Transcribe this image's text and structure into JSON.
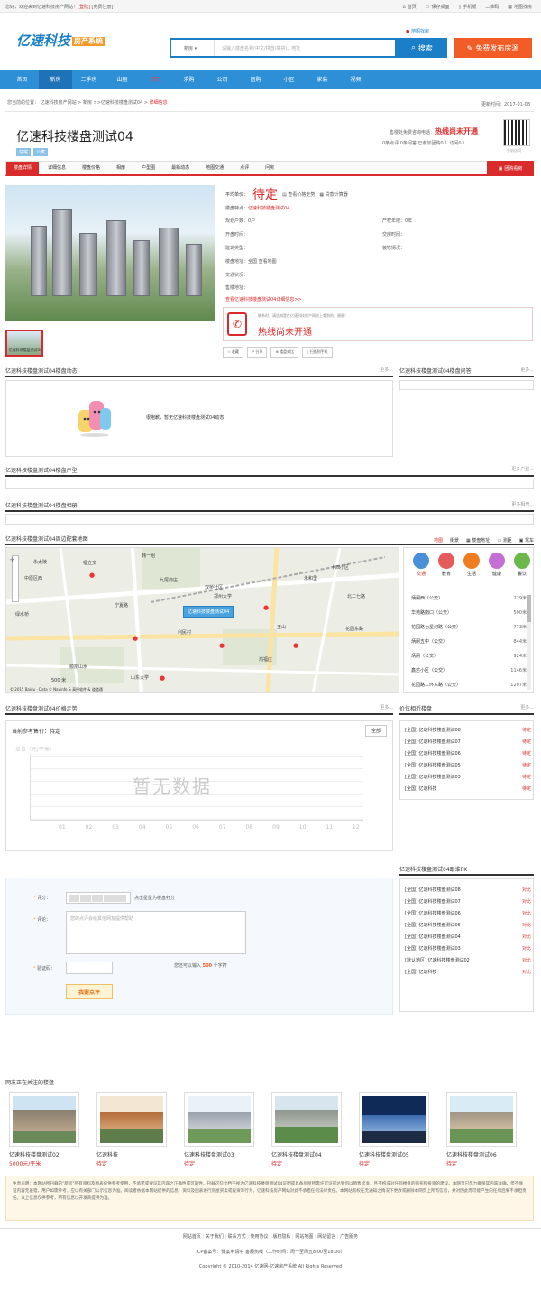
{
  "topbar": {
    "welcome": "您好，欢迎来到亿速科技房产网站！",
    "login": "[登陆]",
    "register": "[免费注册]",
    "links": [
      "首页",
      "保存桌面",
      "手机版",
      "二维码",
      "地图找房"
    ]
  },
  "header": {
    "logo": "亿速科技",
    "logo_tag": "房产系统",
    "map_find": "地图找房",
    "search_select": "新房",
    "search_placeholder": "请输入楼盘名称(中文/拼音/简拼)、地址",
    "search_button": "搜索",
    "publish_button": "免费发布房源"
  },
  "nav": [
    "首页",
    "新房",
    "二手房",
    "出租",
    "资讯",
    "求购",
    "公司",
    "团购",
    "小区",
    "家装",
    "视频"
  ],
  "crumb": {
    "text": "您当前的位置：  亿速科技房产网站  >  新房  >>亿速科技楼盘测试04  >",
    "current": "详细信息"
  },
  "update_time": "更新时间：2017-01-08",
  "property": {
    "title": "亿速科技楼盘测试04",
    "tags": [
      "住宅",
      "公寓"
    ],
    "hotline_label": "售楼处免费咨询电话：",
    "hotline": "热线尚未开通",
    "stats": "0条点评  0条问答  已参加团购0人  访问0人",
    "qr_label": "手机访问"
  },
  "tabs": [
    "楼盘详情",
    "详细信息",
    "楼盘价格",
    "相册",
    "户型图",
    "最新动态",
    "地图交通",
    "点评",
    "问房"
  ],
  "group_button": "团购看房",
  "thumb_label": "亿速科技楼盘测试04",
  "info": {
    "price_label": "平均单价：",
    "price": "待定",
    "price_trend": "查看价格走势",
    "loan_calc": "贷款计算器",
    "feature_label": "楼盘特点：",
    "feature": "亿速科技楼盘测试04",
    "rows": [
      [
        "规划户数：",
        "0户",
        "产权年限：",
        "0年"
      ],
      [
        "开盘时间：",
        "",
        "交房时间：",
        ""
      ],
      [
        "建筑类型：",
        "",
        "装修情况：",
        ""
      ],
      [
        "楼盘地址：",
        "全国   查看地图",
        "",
        ""
      ],
      [
        "交通状况：",
        "",
        "",
        ""
      ],
      [
        "售楼地址：",
        "",
        "",
        ""
      ]
    ],
    "more": "查看亿速科技楼盘测试04详细信息>>",
    "hot_note": "联系时，请告知是在亿速科技房产网站上看到的，谢谢！",
    "hot_big": "热线尚未开通",
    "tools": [
      "收藏",
      "分享",
      "楼盘对比",
      "扫描到手机"
    ]
  },
  "sections": {
    "dynamic": "亿速科技楼盘测试04楼盘动态",
    "qa": "亿速科技楼盘测试04楼盘问答",
    "more": "更多...",
    "nodata": "很抱歉，暂无亿速科技楼盘测试04动态",
    "layout": "亿速科技楼盘测试04楼盘户型",
    "layout_more": "更多户型...",
    "album": "亿速科技楼盘测试04楼盘相册",
    "album_more": "更多相册...",
    "map": "亿速科技楼盘测试04周边配套地图",
    "price": "亿速科技楼盘测试04价格走势",
    "similar": "价位相近楼盘",
    "pk": "亿速科技楼盘测试04跟谁PK",
    "watch": "网友正在关注的楼盘"
  },
  "map": {
    "tabs": [
      "地图",
      "街景",
      "楼盘地址",
      "测距",
      "驾车"
    ],
    "marker": "亿速科技楼盘测试04",
    "scale": "500 米",
    "copyright": "© 2015 Baidu - Data © Navinfo & 高德软件 & 道道通",
    "places": [
      "永太陵",
      "福立交",
      "韩一组",
      "中原区西",
      "双桥社区",
      "九尾商庄",
      "绿水桥",
      "永和里",
      "北二七路",
      "郑州大学",
      "十四小区",
      "王山",
      "花园东路",
      "山东大学",
      "利民村",
      "宁夏路",
      "鸿福庄",
      "顺凯山水"
    ],
    "cats": [
      "交通",
      "教育",
      "生活",
      "健康",
      "餐饮"
    ],
    "bus": [
      [
        "炳闸西（公交）",
        "229米"
      ],
      [
        "华苑路南口（公交）",
        "500米"
      ],
      [
        "花园路七星河路（公交）",
        "773米"
      ],
      [
        "炳闸五中（公交）",
        "844米"
      ],
      [
        "炳闸（公交）",
        "924米"
      ],
      [
        "鑫达小区（公交）",
        "1146米"
      ],
      [
        "花园路二环东路（公交）",
        "1207米"
      ]
    ]
  },
  "price_chart": {
    "ref_label": "当前参考售价：",
    "ref_value": "待定",
    "all_button": "全部",
    "unit": "单位（元/平米）",
    "nodata": "暂无数据",
    "months": [
      "01",
      "02",
      "03",
      "04",
      "05",
      "06",
      "07",
      "08",
      "09",
      "10",
      "11",
      "12"
    ]
  },
  "similar": [
    [
      "[全国] 亿速科技楼盘测试08",
      "待定"
    ],
    [
      "[全国] 亿速科技楼盘测试07",
      "待定"
    ],
    [
      "[全国] 亿速科技楼盘测试06",
      "待定"
    ],
    [
      "[全国] 亿速科技楼盘测试05",
      "待定"
    ],
    [
      "[全国] 亿速科技楼盘测试03",
      "待定"
    ],
    [
      "[全国] 亿速科技",
      "待定"
    ]
  ],
  "pk": [
    [
      "[全国] 亿速科技楼盘测试08",
      "对比"
    ],
    [
      "[全国] 亿速科技楼盘测试07",
      "对比"
    ],
    [
      "[全国] 亿速科技楼盘测试06",
      "对比"
    ],
    [
      "[全国] 亿速科技楼盘测试05",
      "对比"
    ],
    [
      "[全国] 亿速科技楼盘测试04",
      "对比"
    ],
    [
      "[全国] 亿速科技楼盘测试03",
      "对比"
    ],
    [
      "[默认地区] 亿速科技楼盘测试02",
      "对比"
    ],
    [
      "[全国] 亿速科技",
      "对比"
    ]
  ],
  "comment": {
    "score_label": "评分：",
    "score_hint": "点击星星为楼盘打分",
    "review_label": "评论：",
    "review_placeholder": "您的点评会给其他网友提供帮助",
    "code_label": "验证码：",
    "limit_prefix": "您还可以输入",
    "limit_num": "500",
    "limit_suffix": "个字符",
    "submit": "我要点评"
  },
  "watch_cards": [
    [
      "亿速科技楼盘测试02",
      "5000元/平米"
    ],
    [
      "亿速科技",
      "待定"
    ],
    [
      "亿速科技楼盘测试03",
      "待定"
    ],
    [
      "亿速科技楼盘测试04",
      "待定"
    ],
    [
      "亿速科技楼盘测试05",
      "待定"
    ],
    [
      "亿速科技楼盘测试06",
      "待定"
    ]
  ],
  "disclaimer": "免责声明：本网站所刊载的\"新房\"所有资料及图表仅供参考使用，不承诺或保证其内容之正确性或可靠性。刊载这些文档不视为亿速科技楼盘测试04证明或具备房屋所需许可证或达到何以销售标准，且不构成对任何楼盘的购买和投资的建议。本网页已尽力确保其内容准确，但不保证内容无差错，用户如需参考，应以有关部门公示信息为准。阅读者依据本网站提供的信息、资料及图表进行房屋买卖或投资等行为，亿速科技房产网站对此不承担任何法律责任。本网站有权在无通知之情况下更改或删除本网页上所有信息，并对因此而可能产生的任何后果不承担责任。以上信息仅供参考，所有信息以开发商提供为准。",
  "footer": {
    "links": [
      "网站首页",
      "关于我们",
      "联系方式",
      "使用协议",
      "版权隐私",
      "网站地图",
      "网站留言",
      "广告服务"
    ],
    "icp": "ICP备案号：豫案申请中  客服热线（工作时间：周一至周五8:00至18:00）",
    "copyright": "Copyright © 2010-2014 亿速网-亿速房产系统 All Rights Reserved"
  }
}
